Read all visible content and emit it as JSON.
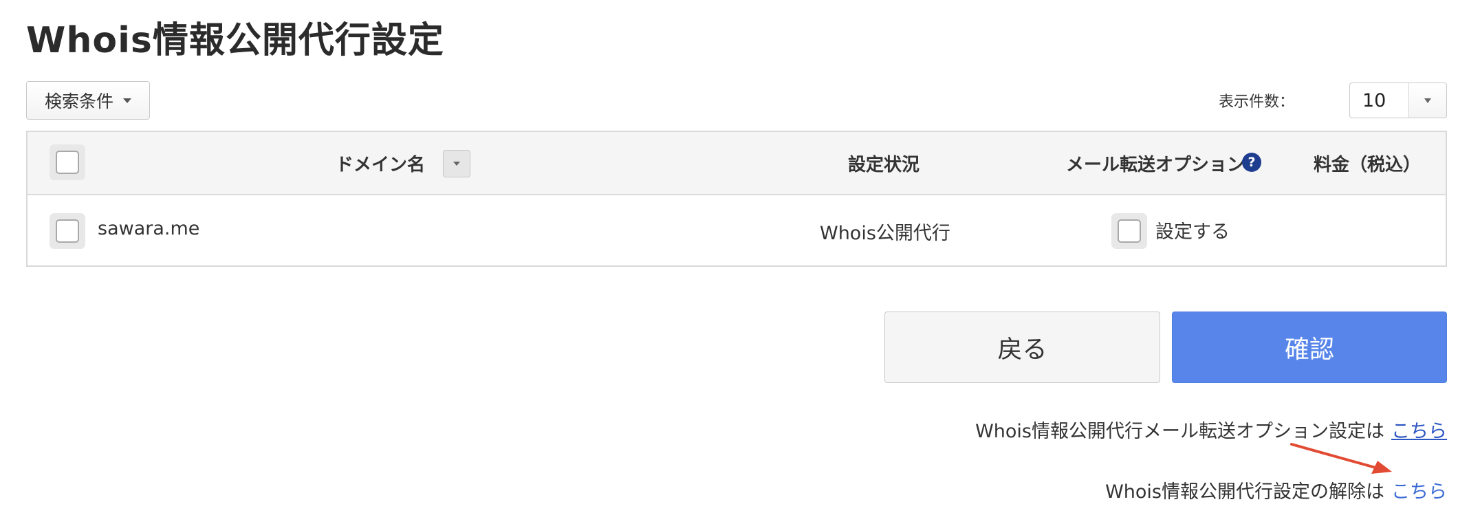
{
  "page_title": "Whois情報公開代行設定",
  "search_conditions": {
    "label": "検索条件",
    "icon": "caret-down-icon"
  },
  "display_count": {
    "label": "表示件数：",
    "value": "10"
  },
  "table": {
    "headers": {
      "domain": "ドメイン名",
      "status": "設定状況",
      "mail_forward": "メール転送オプション",
      "price": "料金（税込）"
    },
    "help_icon_text": "?",
    "rows": [
      {
        "domain": "sawara.me",
        "status": "Whois公開代行",
        "mail_forward_label": "設定する",
        "price": ""
      }
    ]
  },
  "buttons": {
    "back": "戻る",
    "confirm": "確認"
  },
  "links": {
    "mail_forward_text": "Whois情報公開代行メール転送オプション設定は",
    "mail_forward_link": "こちら",
    "release_text": "Whois情報公開代行設定の解除は",
    "release_link": "こちら"
  },
  "colors": {
    "confirm_button": "#5785ea",
    "link": "#2b55c2",
    "annotation_arrow": "#e24b33",
    "help_icon": "#1f3d8f"
  }
}
